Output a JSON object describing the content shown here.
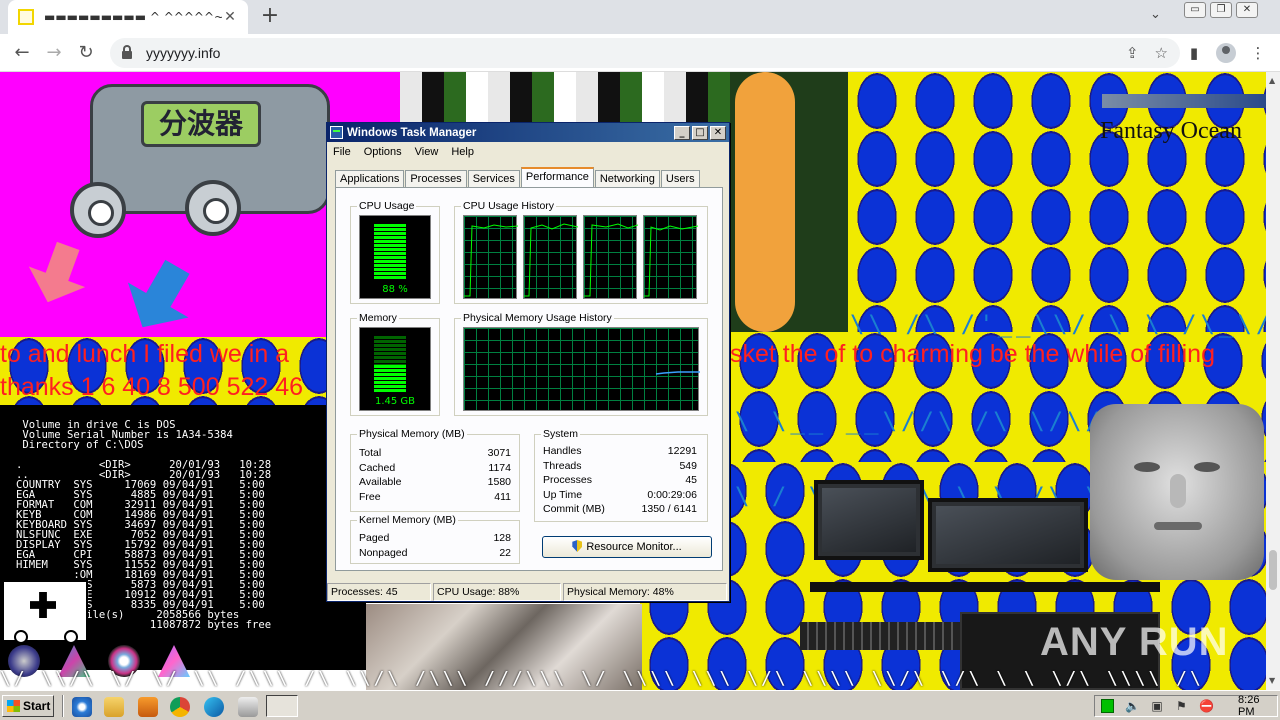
{
  "browser": {
    "tab_title": "▬▬▬▬▬▬▬▬▬ ^ ^^^^^~ ↟|ui█▬",
    "tab_close": "✕",
    "new_tab": "+",
    "tab_dropdown": "⌄",
    "url": "yyyyyyy.info",
    "window_buttons": [
      "▭",
      "❐",
      "✕"
    ]
  },
  "page": {
    "splitter_label": "分波器",
    "fantasy_text": "Fantasy Ocean",
    "red_text_1_left": "to and lunch I filed we in a",
    "red_text_1_right": "sket the of to charming be the while of filling",
    "red_text_2": "thanks 1 6 40 8 500 522 46",
    "ascii_1": "\\\\ /\\ /'__\\\\/ \\ \\ /\\_\\/\\_\\",
    "ascii_2": "\\ \\__ __\\//\\ /\\ \\/\\/ \\",
    "ascii_3": "\\ / \\/ \\ \\\\ \\ \\ /\\ \\\\",
    "ascii_bottom": "\\/ \\\\/\\ \\/ \\/ \\\\ /\\\\\\ /\\ \\\\/\\ /\\\\\\ ///\\\\\\ \\/ \\\\\\\\ \\\\\\ \\/\\ \\\\\\\\ \\\\/\\ \\/\\ \\ \\ \\/\\ \\\\\\\\ /\\",
    "dos_lines": [
      " Volume in drive C is DOS",
      " Volume Serial Number is 1A34-5384",
      " Directory of C:\\DOS",
      "",
      ".            <DIR>      20/01/93   10:28",
      "..           <DIR>      20/01/93   10:28",
      "COUNTRY  SYS     17069 09/04/91    5:00",
      "EGA      SYS      4885 09/04/91    5:00",
      "FORMAT   COM     32911 09/04/91    5:00",
      "KEYB     COM     14986 09/04/91    5:00",
      "KEYBOARD SYS     34697 09/04/91    5:00",
      "NLSFUNC  EXE      7052 09/04/91    5:00",
      "DISPLAY  SYS     15792 09/04/91    5:00",
      "EGA      CPI     58873 09/04/91    5:00",
      "HIMEM    SYS     11552 09/04/91    5:00",
      "         :OM     18169 09/04/91    5:00",
      "         :YS      5873 09/04/91    5:00",
      "         :XE     10912 09/04/91    5:00",
      "         :YS      8335 09/04/91    5:00",
      "          file(s)     2058566 bytes",
      "                     11087872 bytes free"
    ],
    "watermark": "ANY RUN"
  },
  "task_manager": {
    "title": "Windows Task Manager",
    "title_buttons": [
      "_",
      "□",
      "✕"
    ],
    "menu": [
      "File",
      "Options",
      "View",
      "Help"
    ],
    "tabs": [
      "Applications",
      "Processes",
      "Services",
      "Performance",
      "Networking",
      "Users"
    ],
    "active_tab": "Performance",
    "cpu_usage_label": "CPU Usage",
    "cpu_usage_value": "88 %",
    "cpu_usage_fraction": 0.88,
    "cpu_history_label": "CPU Usage History",
    "memory_label": "Memory",
    "memory_value": "1.45 GB",
    "memory_fraction": 0.48,
    "phys_history_label": "Physical Memory Usage History",
    "physical_memory": {
      "label": "Physical Memory (MB)",
      "rows": [
        {
          "name": "Total",
          "value": "3071"
        },
        {
          "name": "Cached",
          "value": "1174"
        },
        {
          "name": "Available",
          "value": "1580"
        },
        {
          "name": "Free",
          "value": "411"
        }
      ]
    },
    "kernel_memory": {
      "label": "Kernel Memory (MB)",
      "rows": [
        {
          "name": "Paged",
          "value": "128"
        },
        {
          "name": "Nonpaged",
          "value": "22"
        }
      ]
    },
    "system": {
      "label": "System",
      "rows": [
        {
          "name": "Handles",
          "value": "12291"
        },
        {
          "name": "Threads",
          "value": "549"
        },
        {
          "name": "Processes",
          "value": "45"
        },
        {
          "name": "Up Time",
          "value": "0:00:29:06"
        },
        {
          "name": "Commit (MB)",
          "value": "1350 / 6141"
        }
      ]
    },
    "resource_monitor_button": "Resource Monitor...",
    "status": {
      "processes": "Processes: 45",
      "cpu": "CPU Usage: 88%",
      "memory": "Physical Memory: 48%"
    }
  },
  "taskbar": {
    "start_label": "Start",
    "clock": "8:26 PM"
  }
}
